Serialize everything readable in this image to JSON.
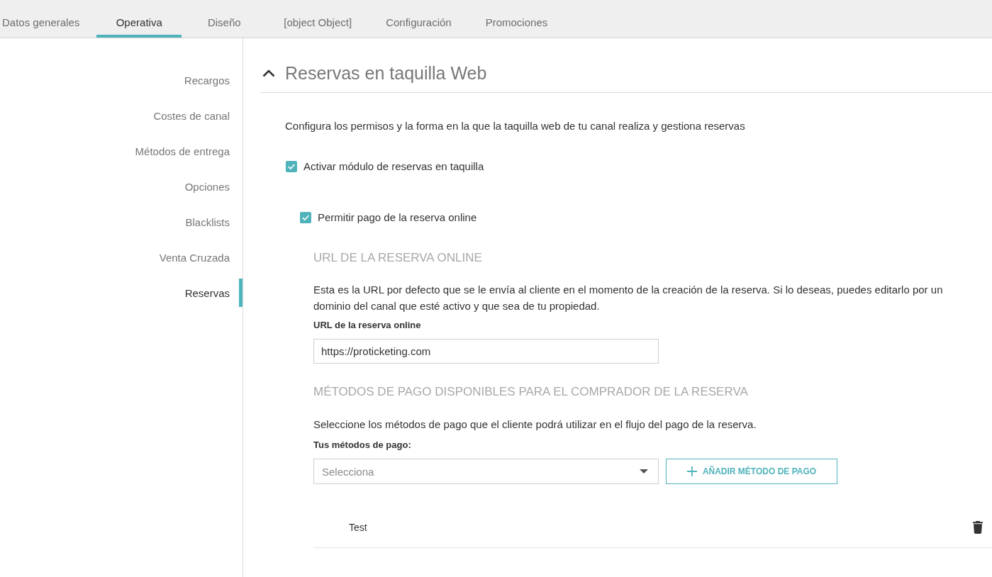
{
  "tabs": [
    {
      "label": "Datos generales",
      "selected": false
    },
    {
      "label": "Operativa",
      "selected": true
    },
    {
      "label": "Diseño",
      "selected": false
    },
    {
      "label": "[object Object]",
      "selected": false
    },
    {
      "label": "Configuración",
      "selected": false
    },
    {
      "label": "Promociones",
      "selected": false
    }
  ],
  "sidebar": {
    "items": [
      {
        "label": "Recargos",
        "selected": false
      },
      {
        "label": "Costes de canal",
        "selected": false
      },
      {
        "label": "Métodos de entrega",
        "selected": false
      },
      {
        "label": "Opciones",
        "selected": false
      },
      {
        "label": "Blacklists",
        "selected": false
      },
      {
        "label": "Venta Cruzada",
        "selected": false
      },
      {
        "label": "Reservas",
        "selected": true
      }
    ]
  },
  "panel": {
    "title": "Reservas en taquilla Web",
    "expanded": true,
    "description": "Configura los permisos y la forma en la que la taquilla web de tu canal realiza y gestiona reservas",
    "module_toggle": {
      "label": "Activar módulo de reservas en taquilla",
      "checked": true
    },
    "online_payment": {
      "label": "Permitir pago de la reserva online",
      "checked": true,
      "url_section": {
        "heading": "URL DE LA RESERVA ONLINE",
        "text": "Esta es la URL por defecto que se le envía al cliente en el momento de la creación de la reserva. Si lo deseas, puedes editarlo por un dominio del canal que esté activo y que sea de tu propiedad.",
        "field_label": "URL de la reserva online",
        "value": "https://proticketing.com"
      },
      "payment_section": {
        "heading": "MÉTODOS DE PAGO DISPONIBLES PARA EL COMPRADOR DE LA RESERVA",
        "text": "Seleccione los métodos de pago que el cliente podrá utilizar en el flujo del pago de la reserva.",
        "field_label": "Tus métodos de pago:",
        "placeholder": "Selecciona",
        "add_button": "AÑADIR MÉTODO DE PAGO",
        "methods": [
          {
            "name": "Test"
          }
        ]
      }
    }
  }
}
